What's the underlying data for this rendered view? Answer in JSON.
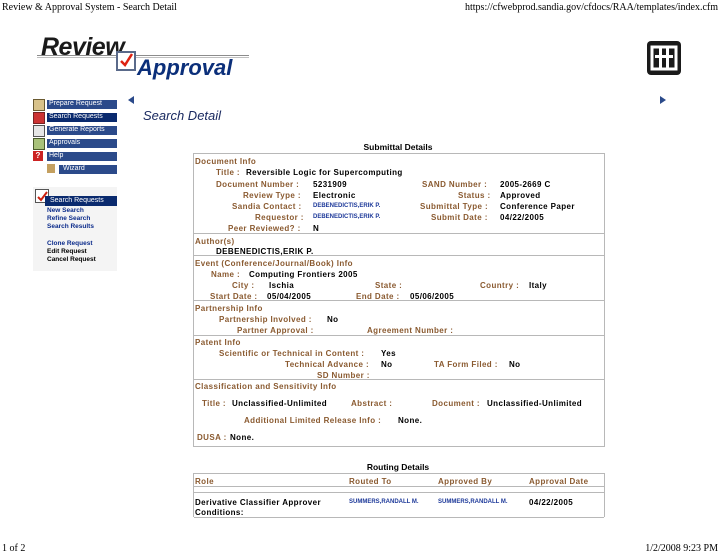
{
  "print_header": {
    "title": "Review & Approval System - Search Detail",
    "url": "https://cfwebprod.sandia.gov/cfdocs/RAA/templates/index.cfm"
  },
  "print_footer": {
    "page": "1 of 2",
    "datetime": "1/2/2008 9:23 PM"
  },
  "logo": {
    "word1": "Review",
    "word2": "Approval"
  },
  "sidebar": {
    "menu": [
      {
        "label": "Prepare Request"
      },
      {
        "label": "Search Requests"
      },
      {
        "label": "Generate Reports"
      },
      {
        "label": "Approvals"
      },
      {
        "label": "Help"
      },
      {
        "label": "Wizard"
      }
    ],
    "section_title": "Search Requests",
    "links1": [
      "New Search",
      "Refine Search",
      "Search Results"
    ],
    "links2": [
      "Clone Request",
      "Edit Request",
      "Cancel Request"
    ]
  },
  "page_title": "Search Detail",
  "submittal": {
    "heading": "Submittal Details",
    "document_info": "Document Info",
    "title_label": "Title :",
    "title_value": "Reversible Logic for Supercomputing",
    "doc_num_label": "Document Number :",
    "doc_num_value": "5231909",
    "sand_label": "SAND Number :",
    "sand_value": "2005-2669 C",
    "review_type_label": "Review Type :",
    "review_type_value": "Electronic",
    "status_label": "Status :",
    "status_value": "Approved",
    "sandia_contact_label": "Sandia Contact :",
    "sandia_contact_value": "DEBENEDICTIS,ERIK P.",
    "submittal_type_label": "Submittal Type :",
    "submittal_type_value": "Conference Paper",
    "requestor_label": "Requestor :",
    "requestor_value": "DEBENEDICTIS,ERIK P.",
    "submit_date_label": "Submit Date :",
    "submit_date_value": "04/22/2005",
    "peer_label": "Peer Reviewed? :",
    "peer_value": "N",
    "authors_heading": "Author(s)",
    "author": "DEBENEDICTIS,ERIK P.",
    "event_heading": "Event (Conference/Journal/Book) Info",
    "name_label": "Name :",
    "name_value": "Computing Frontiers 2005",
    "city_label": "City :",
    "city_value": "Ischia",
    "state_label": "State :",
    "state_value": "",
    "country_label": "Country :",
    "country_value": "Italy",
    "start_label": "Start Date :",
    "start_value": "05/04/2005",
    "end_label": "End Date :",
    "end_value": "05/06/2005",
    "partnership_heading": "Partnership Info",
    "partnership_involved_label": "Partnership Involved :",
    "partnership_involved_value": "No",
    "partner_approval_label": "Partner Approval :",
    "agreement_label": "Agreement Number :",
    "patent_heading": "Patent Info",
    "sci_label": "Scientific or Technical in Content :",
    "sci_value": "Yes",
    "tech_adv_label": "Technical Advance :",
    "tech_adv_value": "No",
    "ta_form_label": "TA Form Filed :",
    "ta_form_value": "No",
    "sd_label": "SD Number :",
    "class_heading": "Classification and Sensitivity Info",
    "c_title_label": "Title :",
    "c_title_value": "Unclassified-Unlimited",
    "abstract_label": "Abstract :",
    "c_doc_label": "Document :",
    "c_doc_value": "Unclassified-Unlimited",
    "addl_label": "Additional Limited Release Info :",
    "addl_value": "None.",
    "dusa_label": "DUSA :",
    "dusa_value": "None."
  },
  "routing": {
    "heading": "Routing Details",
    "columns": [
      "Role",
      "Routed To",
      "Approved By",
      "Approval Date"
    ],
    "row": {
      "role": "Derivative Classifier Approver",
      "routed_to": "SUMMERS,RANDALL M.",
      "approved_by": "SUMMERS,RANDALL M.",
      "date": "04/22/2005"
    },
    "conditions": "Conditions:"
  }
}
